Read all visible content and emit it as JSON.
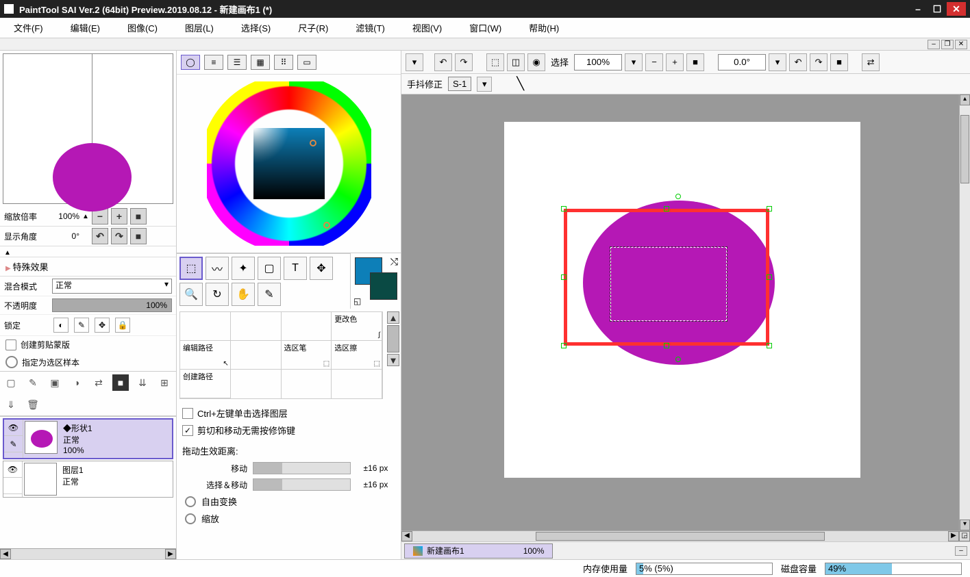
{
  "title": "PaintTool SAI Ver.2 (64bit) Preview.2019.08.12 - 新建画布1 (*)",
  "menu": {
    "file": "文件(F)",
    "edit": "编辑(E)",
    "image": "图像(C)",
    "layer": "图层(L)",
    "select": "选择(S)",
    "ruler": "尺子(R)",
    "filter": "滤镜(T)",
    "view": "视图(V)",
    "window": "窗口(W)",
    "help": "帮助(H)"
  },
  "nav": {
    "zoom_label": "缩放倍率",
    "zoom_value": "100%",
    "angle_label": "显示角度",
    "angle_value": "0°"
  },
  "fx_header": "特殊效果",
  "blend": {
    "label": "混合模式",
    "value": "正常"
  },
  "opacity": {
    "label": "不透明度",
    "value": "100%"
  },
  "lock_label": "锁定",
  "clipping": "创建剪贴蒙版",
  "sel_sample": "指定为选区样本",
  "layers": {
    "shape": {
      "name": "形状1",
      "mode": "正常",
      "opacity": "100%",
      "marker": "◆"
    },
    "bg": {
      "name": "图层1",
      "mode": "正常"
    }
  },
  "subtools": {
    "change_color": "更改色",
    "edit_path": "编辑路径",
    "sel_pen": "选区笔",
    "sel_eraser": "选区擦",
    "create_path": "创建路径"
  },
  "opts": {
    "click_layer": "Ctrl+左键单击选择图层",
    "cut_move": "剪切和移动无需按修饰键",
    "drag_header": "拖动生效距离:",
    "move": "移动",
    "move_val": "±16 px",
    "sel_move": "选择＆移动",
    "sel_move_val": "±16 px",
    "free": "自由变换",
    "scale": "缩放"
  },
  "top_tb": {
    "sel_label": "选择",
    "zoom": "100%",
    "angle": "0.0°"
  },
  "stab": {
    "label": "手抖修正",
    "value": "S-1"
  },
  "doc": {
    "name": "新建画布1",
    "zoom": "100%"
  },
  "status": {
    "mem_label": "内存使用量",
    "mem_value": "5% (5%)",
    "disk_label": "磁盘容量",
    "disk_value": "49%"
  }
}
